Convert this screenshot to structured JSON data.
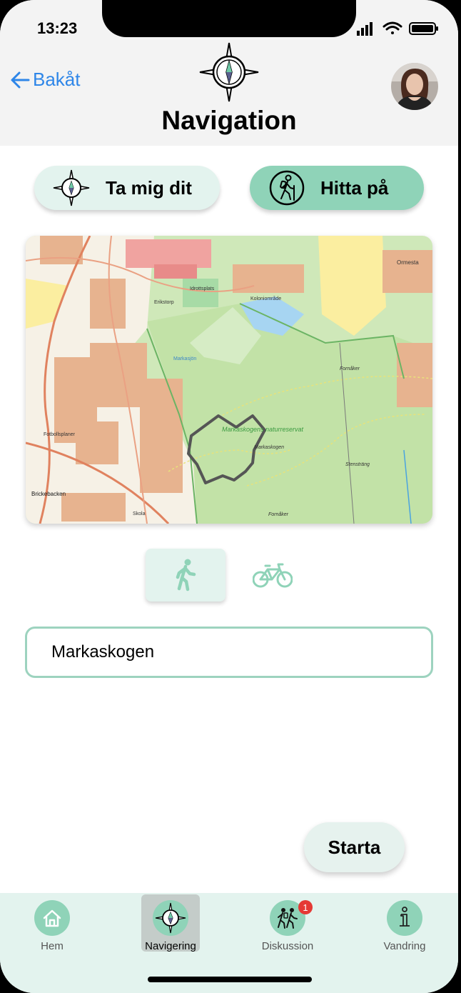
{
  "status": {
    "time": "13:23"
  },
  "header": {
    "back_label": "Bakåt",
    "title": "Navigation"
  },
  "modes": {
    "take_me": "Ta mig dit",
    "find": "Hitta på"
  },
  "map": {
    "labels": {
      "fotbollsplaner": "Fotbollsplaner",
      "idrottsplats": "Idrottsplats",
      "erikstorp": "Erikstorp",
      "koloniomrade": "Koloniområde",
      "ormesta": "Ormesta",
      "markasjon": "Markasjön",
      "reservat": "Markaskogens naturreservat",
      "markaskogen": "Markaskogen",
      "fornaker": "Fornåker",
      "brickebacken": "Brickebacken",
      "skola": "Skola",
      "stenstrang": "Stensträng"
    }
  },
  "transport": {
    "walk": "walk",
    "bike": "bike"
  },
  "destination": {
    "value": "Markaskogen"
  },
  "actions": {
    "start": "Starta"
  },
  "tabs": {
    "home": "Hem",
    "navigation": "Navigering",
    "discussion": "Diskussion",
    "discussion_badge": "1",
    "hiking": "Vandring"
  }
}
